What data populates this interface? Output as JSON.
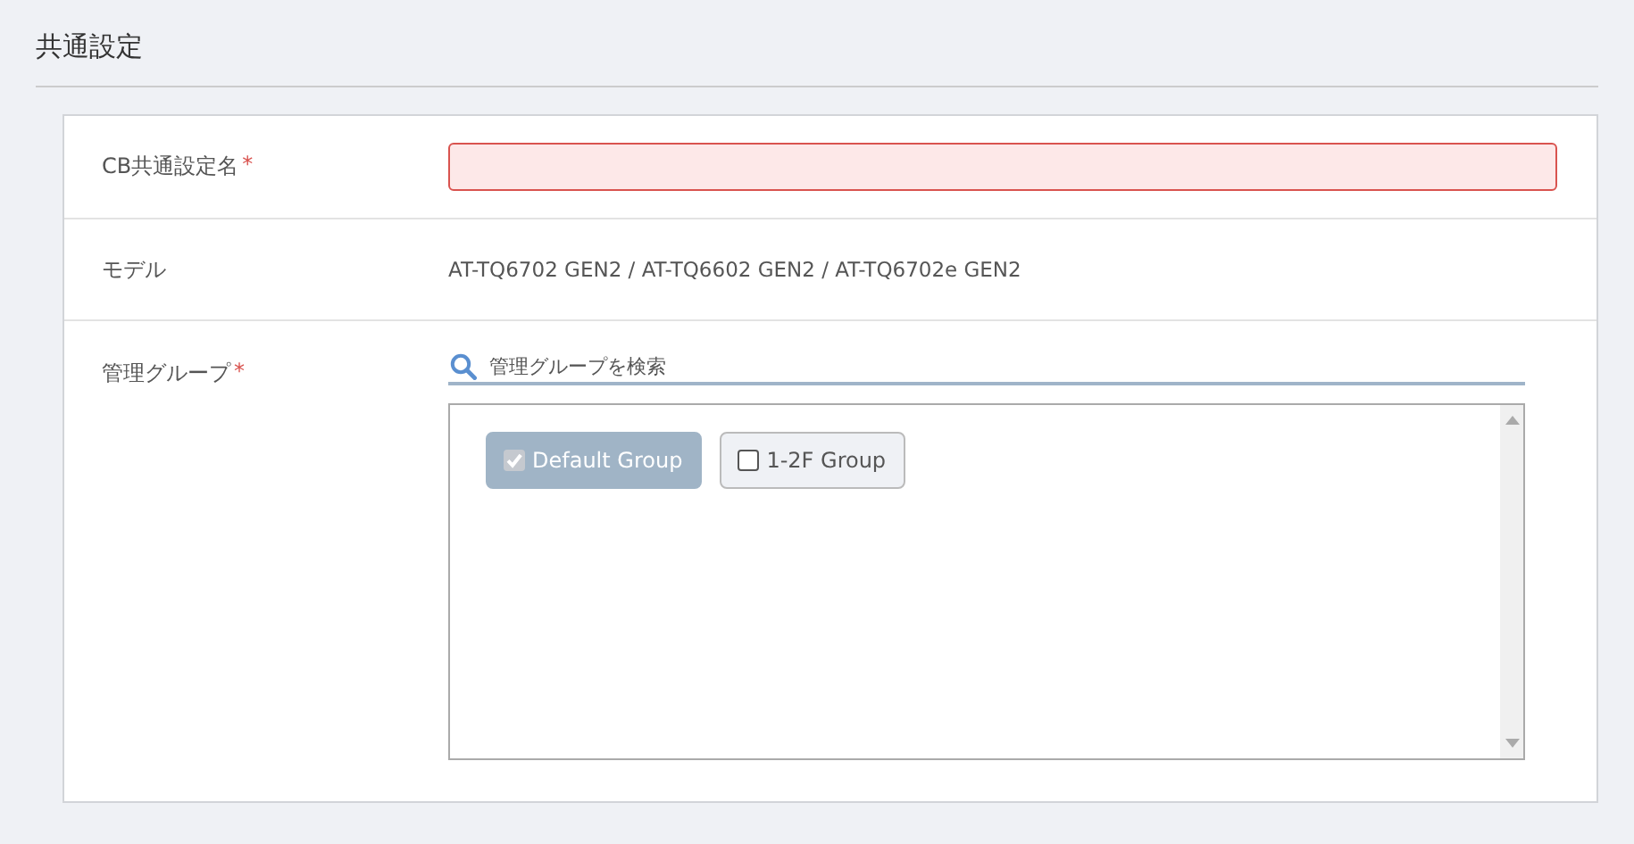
{
  "page_title": "共通設定",
  "fields": [
    {
      "kind": "text_input",
      "label": "CB共通設定名",
      "required_mark": "*",
      "invalid": true
    },
    {
      "kind": "static",
      "label": "モデル",
      "value": "AT-TQ6702 GEN2 / AT-TQ6602 GEN2 / AT-TQ6702e GEN2"
    },
    {
      "kind": "group_picker",
      "label": "管理グループ",
      "required_mark": "*",
      "search": {
        "placeholder": "管理グループを検索"
      },
      "groups": [
        {
          "label": "Default Group",
          "checked": true
        },
        {
          "label": "1-2F Group",
          "checked": false
        }
      ]
    }
  ]
}
